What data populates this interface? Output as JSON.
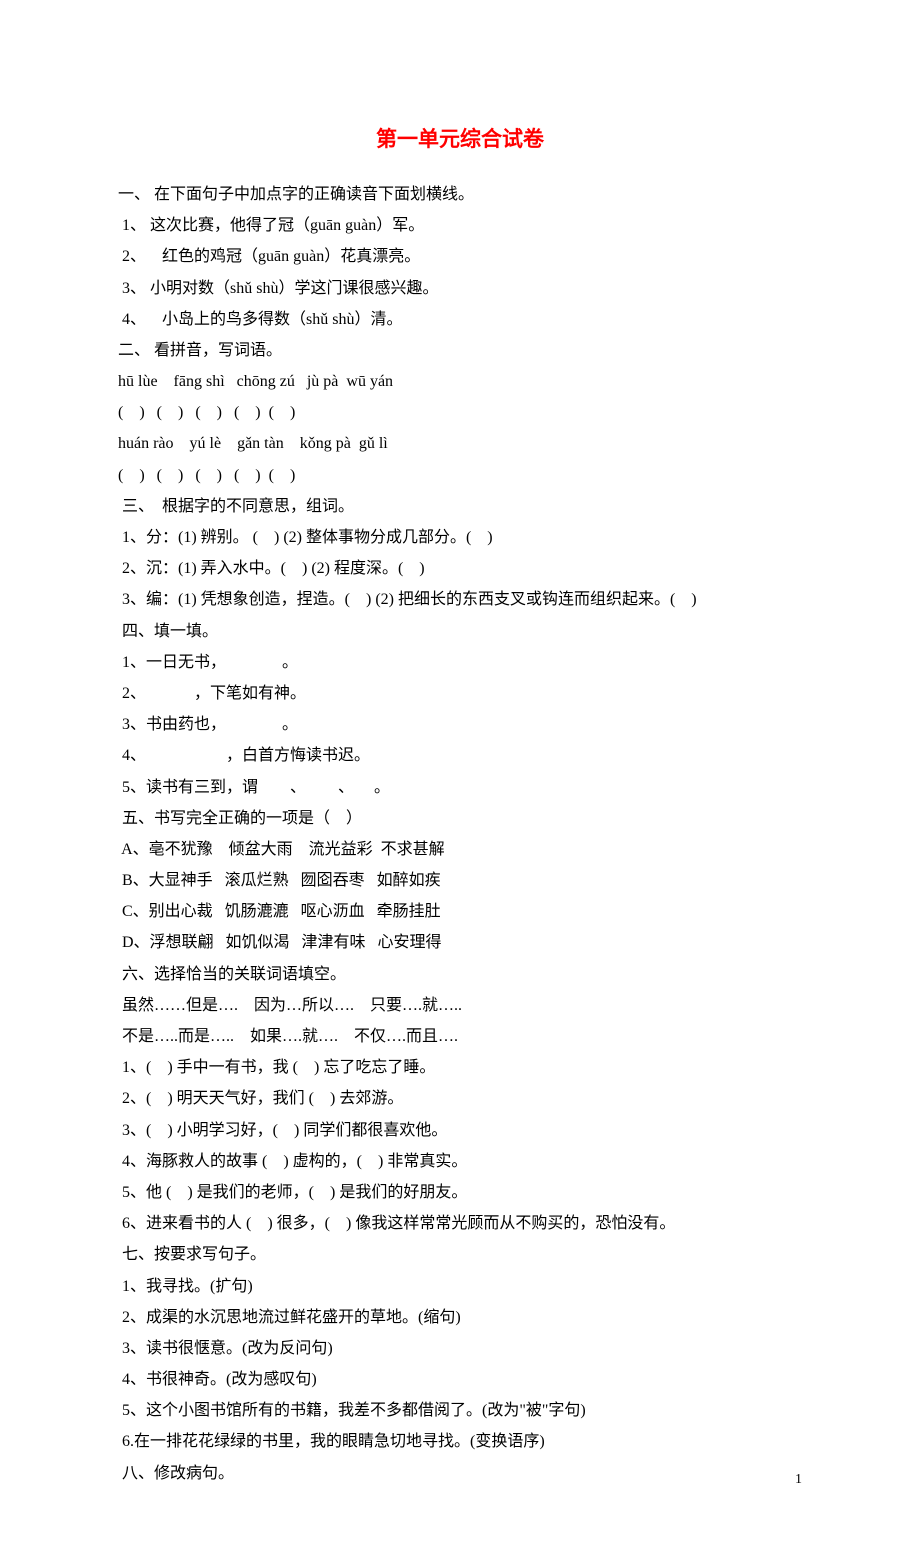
{
  "title": "第一单元综合试卷",
  "lines": [
    "一、 在下面句子中加点字的正确读音下面划横线。",
    " 1、 这次比赛，他得了冠（guān guàn）军。",
    " 2、    红色的鸡冠（guān guàn）花真漂亮。",
    " 3、 小明对数（shǔ shù）学这门课很感兴趣。",
    " 4、    小岛上的鸟多得数（shǔ shù）清。",
    "二、 看拼音，写词语。",
    "hū lùe    fāng shì   chōng zú   jù pà  wū yán",
    "(    )   (    )   (    )   (    )  (    )",
    "huán rào    yú lè    gǎn tàn    kǒng pà  gǔ lì",
    "(    )   (    )   (    )   (    )  (    )",
    " 三、  根据字的不同意思，组词。",
    " 1、分：(1) 辨别。 (    ) (2) 整体事物分成几部分。(    )",
    " 2、沉：(1) 弄入水中。(    ) (2) 程度深。(    )",
    " 3、编：(1) 凭想象创造，捏造。(    ) (2) 把细长的东西支叉或钩连而组织起来。(    )",
    " 四、填一填。",
    " 1、一日无书，              。",
    " 2、            ，下笔如有神。",
    " 3、书由药也，              。",
    " 4、                    ，白首方悔读书迟。",
    " 5、读书有三到，谓        、        、     。",
    " 五、书写完全正确的一项是（    ）",
    " A、亳不犹豫    倾盆大雨    流光益彩  不求甚解",
    " B、大显神手   滚瓜烂熟   囫囵吞枣   如醉如疾",
    " C、别出心裁   饥肠漉漉   呕心沥血   牵肠挂肚",
    " D、浮想联翩   如饥似渴   津津有味   心安理得",
    " 六、选择恰当的关联词语填空。",
    " 虽然……但是….    因为…所以….    只要….就…..",
    " 不是…..而是…..    如果….就….    不仅….而且….",
    " 1、(    ) 手中一有书，我 (    ) 忘了吃忘了睡。",
    " 2、(    ) 明天天气好，我们 (    ) 去郊游。",
    " 3、(    ) 小明学习好，(    ) 同学们都很喜欢他。",
    " 4、海豚救人的故事 (    ) 虚构的，(    ) 非常真实。",
    " 5、他 (    ) 是我们的老师，(    ) 是我们的好朋友。",
    " 6、进来看书的人 (    ) 很多，(    ) 像我这样常常光顾而从不购买的，恐怕没有。",
    " 七、按要求写句子。",
    " 1、我寻找。(扩句)",
    " 2、成渠的水沉思地流过鲜花盛开的草地。(缩句)",
    " 3、读书很惬意。(改为反问句)",
    " 4、书很神奇。(改为感叹句)",
    " 5、这个小图书馆所有的书籍，我差不多都借阅了。(改为\"被\"字句)",
    " 6.在一排花花绿绿的书里，我的眼睛急切地寻找。(变换语序)",
    " 八、修改病句。"
  ],
  "pageNumber": "1"
}
